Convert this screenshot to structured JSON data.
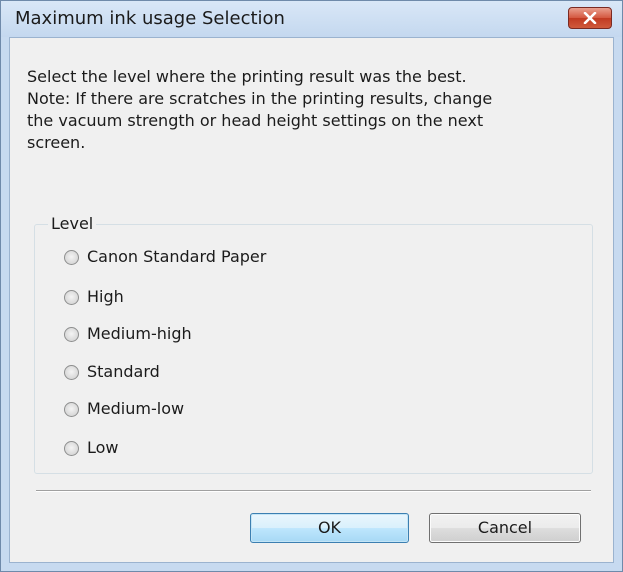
{
  "window": {
    "title": "Maximum ink usage Selection"
  },
  "message": {
    "line1": "Select the level where the printing result was the best.",
    "line2": "Note: If there are scratches in the printing results, change",
    "line3": "the vacuum strength or head height settings on the next",
    "line4": "screen."
  },
  "level_group": {
    "label": "Level",
    "options": [
      {
        "label": "Canon Standard Paper",
        "selected": false
      },
      {
        "label": "High",
        "selected": false
      },
      {
        "label": "Medium-high",
        "selected": false
      },
      {
        "label": "Standard",
        "selected": false
      },
      {
        "label": "Medium-low",
        "selected": false
      },
      {
        "label": "Low",
        "selected": false
      }
    ]
  },
  "buttons": {
    "ok": "OK",
    "cancel": "Cancel"
  },
  "colors": {
    "close_button": "#c9452c",
    "default_button_border": "#3c7fb1"
  }
}
